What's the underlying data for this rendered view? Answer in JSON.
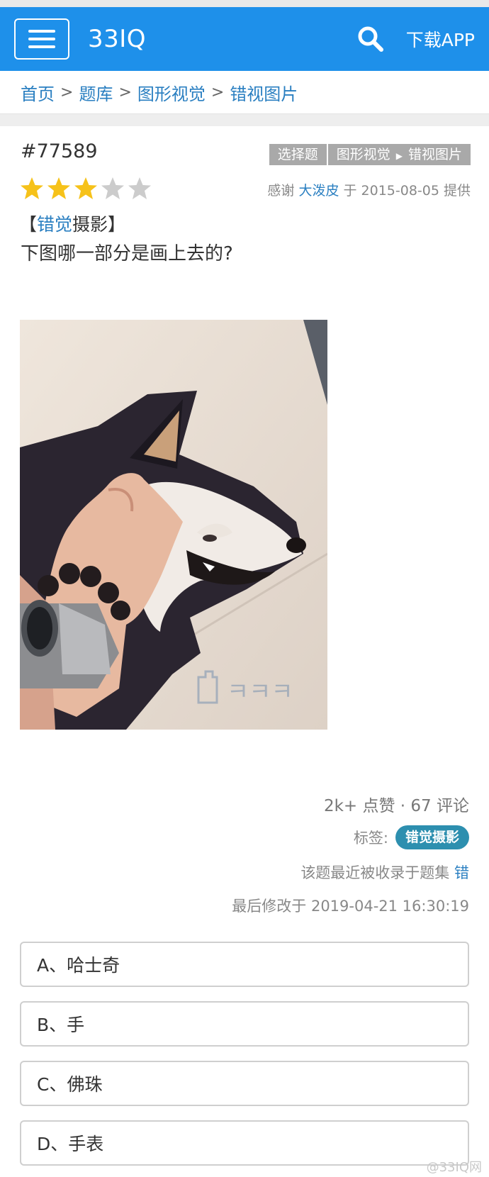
{
  "header": {
    "brand": "33IQ",
    "download": "下载APP"
  },
  "breadcrumb": [
    "首页",
    "题库",
    "图形视觉",
    "错视图片"
  ],
  "question": {
    "id": "#77589",
    "tags": [
      "选择题",
      "图形视觉",
      "错视图片"
    ],
    "rating": 3,
    "rating_max": 5,
    "thanks_prefix": "感谢",
    "thanks_user": "大泼皮",
    "thanks_date": "于 2015-08-05 提供",
    "title_open": "【",
    "title_hl": "错觉",
    "title_rest": "摄影】",
    "text": "下图哪一部分是画上去的?"
  },
  "stats": {
    "likes": "2k+ 点赞 · 67 评论",
    "tag_label": "标签:",
    "tag_value": "错觉摄影",
    "collected_text": "该题最近被收录于题集",
    "collected_link": "错",
    "modified": "最后修改于 2019-04-21 16:30:19"
  },
  "options": [
    "A、哈士奇",
    "B、手",
    "C、佛珠",
    "D、手表"
  ],
  "photo": {
    "watermark": "ㅋㅋㅋ"
  },
  "watermark": "@33IQ网",
  "colors": {
    "primary": "#1e90ea",
    "link": "#2a7fc1",
    "star_on": "#f6c21a",
    "star_off": "#cccccc",
    "pill": "#2d8faf"
  }
}
